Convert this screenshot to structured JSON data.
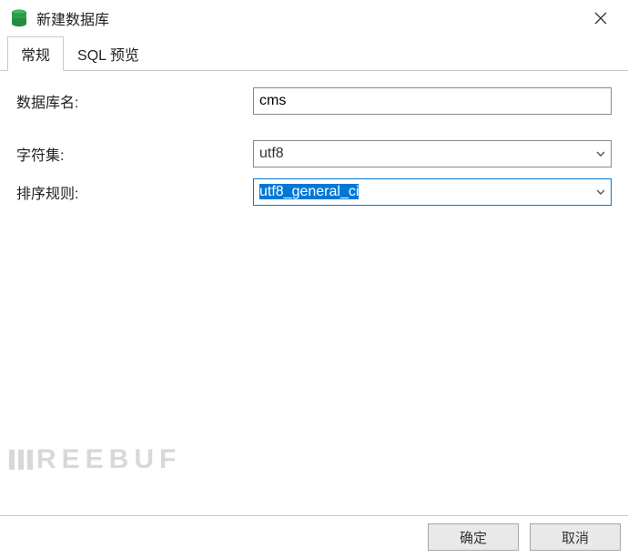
{
  "window": {
    "title": "新建数据库"
  },
  "tabs": {
    "general": "常规",
    "sql_preview": "SQL 预览"
  },
  "form": {
    "db_name_label": "数据库名:",
    "db_name_value": "cms",
    "charset_label": "字符集:",
    "charset_value": "utf8",
    "collation_label": "排序规则:",
    "collation_value": "utf8_general_ci"
  },
  "buttons": {
    "ok": "确定",
    "cancel": "取消"
  },
  "watermark": "REEBUF"
}
